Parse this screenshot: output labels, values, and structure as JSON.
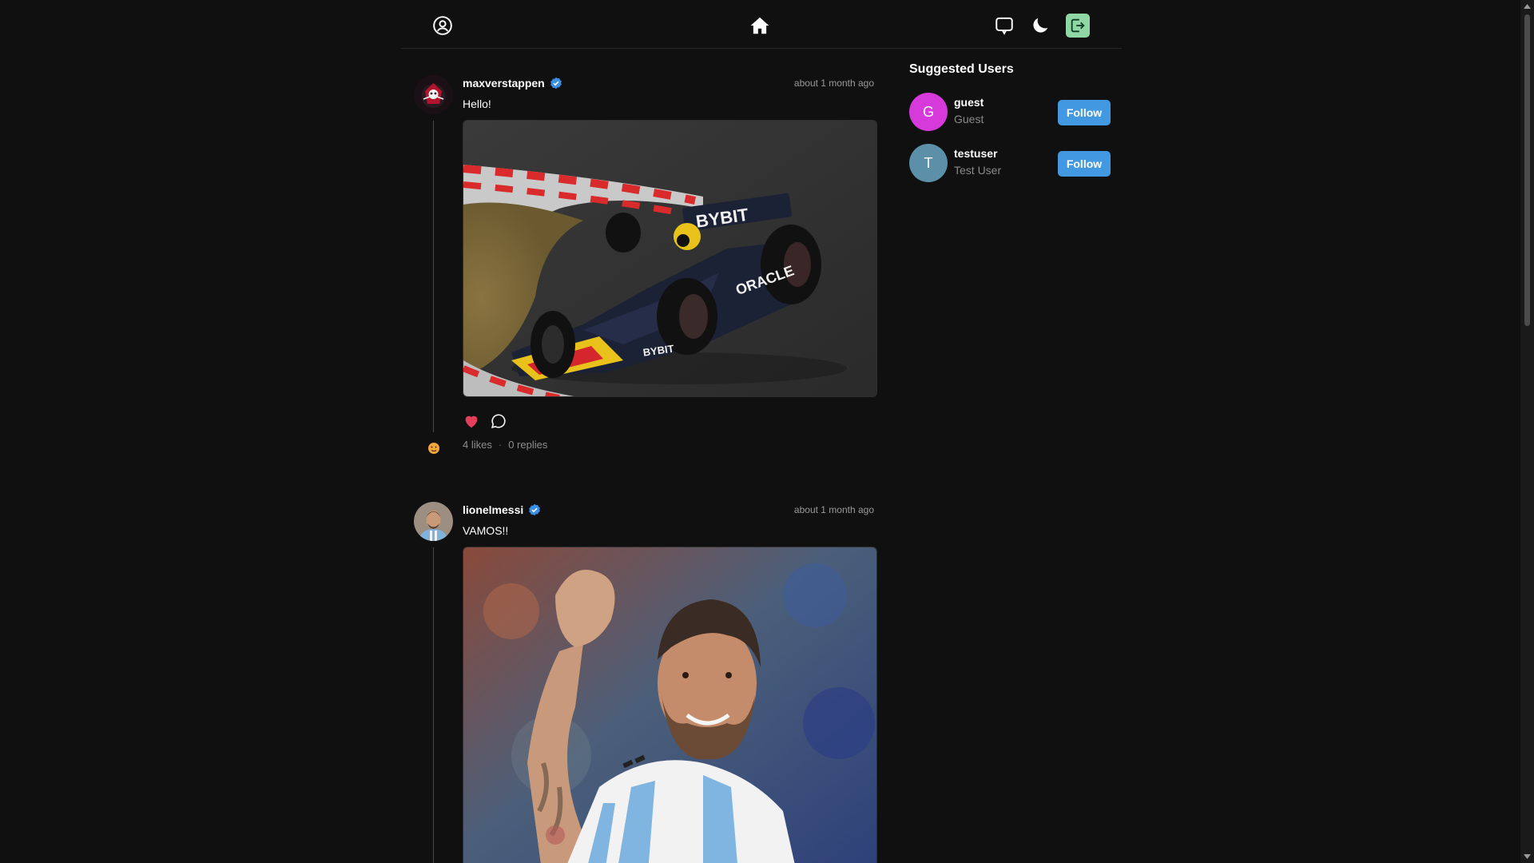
{
  "header": {
    "profile_icon": "user-circle-icon",
    "home_icon": "home-icon",
    "chat_icon": "chat-bubble-icon",
    "theme_icon": "moon-icon",
    "logout_icon": "logout-icon"
  },
  "feed": {
    "posts": [
      {
        "username": "maxverstappen",
        "verified": true,
        "time": "about 1 month ago",
        "text": "Hello!",
        "image": "Formula 1 car on track",
        "liked": true,
        "likes": "4 likes",
        "replies": "0 replies",
        "separator": "·"
      },
      {
        "username": "lionelmessi",
        "verified": true,
        "time": "about 1 month ago",
        "text": "VAMOS!!",
        "image": "Footballer celebrating with raised fist"
      }
    ]
  },
  "sidebar": {
    "title": "Suggested Users",
    "users": [
      {
        "initial": "G",
        "username": "guest",
        "name": "Guest",
        "button": "Follow",
        "color": "#d63adb"
      },
      {
        "initial": "T",
        "username": "testuser",
        "name": "Test User",
        "button": "Follow",
        "color": "#5c8fa8"
      }
    ]
  },
  "colors": {
    "background": "#101010",
    "accent": "#4299e1",
    "like": "#e53e5a",
    "logout_bg": "#8fd8a6"
  }
}
